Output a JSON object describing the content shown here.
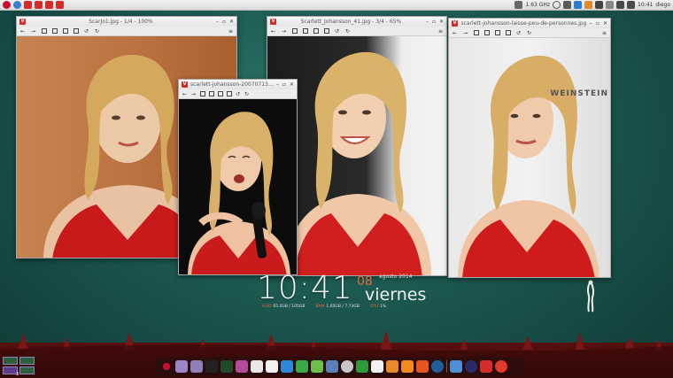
{
  "top_panel": {
    "cpu": "1.63 GHz",
    "time": "10:41",
    "user": "diego"
  },
  "windows": [
    {
      "title": "ScarJo1.jpg - 1/4 - 100%"
    },
    {
      "title": "scarlett-johansson-20070713-..."
    },
    {
      "title": "Scarlett_Johansson_41.jpg - 3/4 - 65%"
    },
    {
      "title": "scarlett-johansson-laisse-peu-de-personnes.jpg"
    }
  ],
  "clock": {
    "time": "10:41",
    "day": "08",
    "month": "agosto 2014",
    "weekday": "viernes",
    "hdd_label": "HDD",
    "hdd_value": "65.0GB / 105GB",
    "ram_label": "RAM",
    "ram_value": "1.60GB / 7.73GB",
    "cpu_label": "CPU",
    "cpu_value": "1%"
  },
  "poster_text": "WEINSTEIN",
  "workspace": {
    "count": "3"
  },
  "colors": {
    "accent_red": "#d42b2b",
    "clock_orange": "#e46a3a",
    "desktop_teal": "#1d5a52"
  }
}
